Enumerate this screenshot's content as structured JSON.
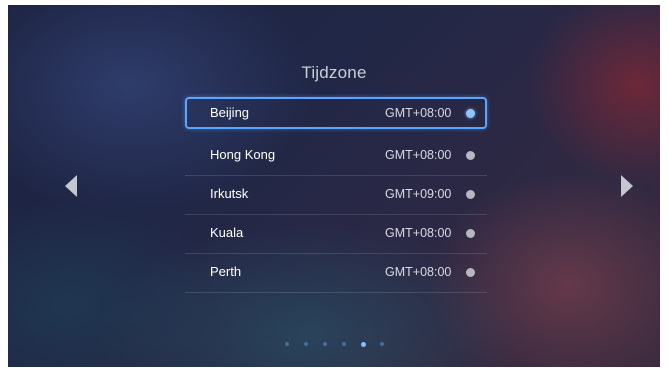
{
  "screen": {
    "title": "Tijdzone"
  },
  "timezones": [
    {
      "name": "Beijing",
      "offset": "GMT+08:00",
      "selected": true
    },
    {
      "name": "Hong Kong",
      "offset": "GMT+08:00",
      "selected": false
    },
    {
      "name": "Irkutsk",
      "offset": "GMT+09:00",
      "selected": false
    },
    {
      "name": "Kuala",
      "offset": "GMT+08:00",
      "selected": false
    },
    {
      "name": "Perth",
      "offset": "GMT+08:00",
      "selected": false
    }
  ],
  "navigation": {
    "left_icon": "chevron-left-icon",
    "right_icon": "chevron-right-icon"
  },
  "pager": {
    "total": 6,
    "current": 5
  },
  "colors": {
    "selection": "#5aa6ff",
    "selected_radio": "#8ec4ff",
    "unselected_radio": "#b6b8c0"
  }
}
